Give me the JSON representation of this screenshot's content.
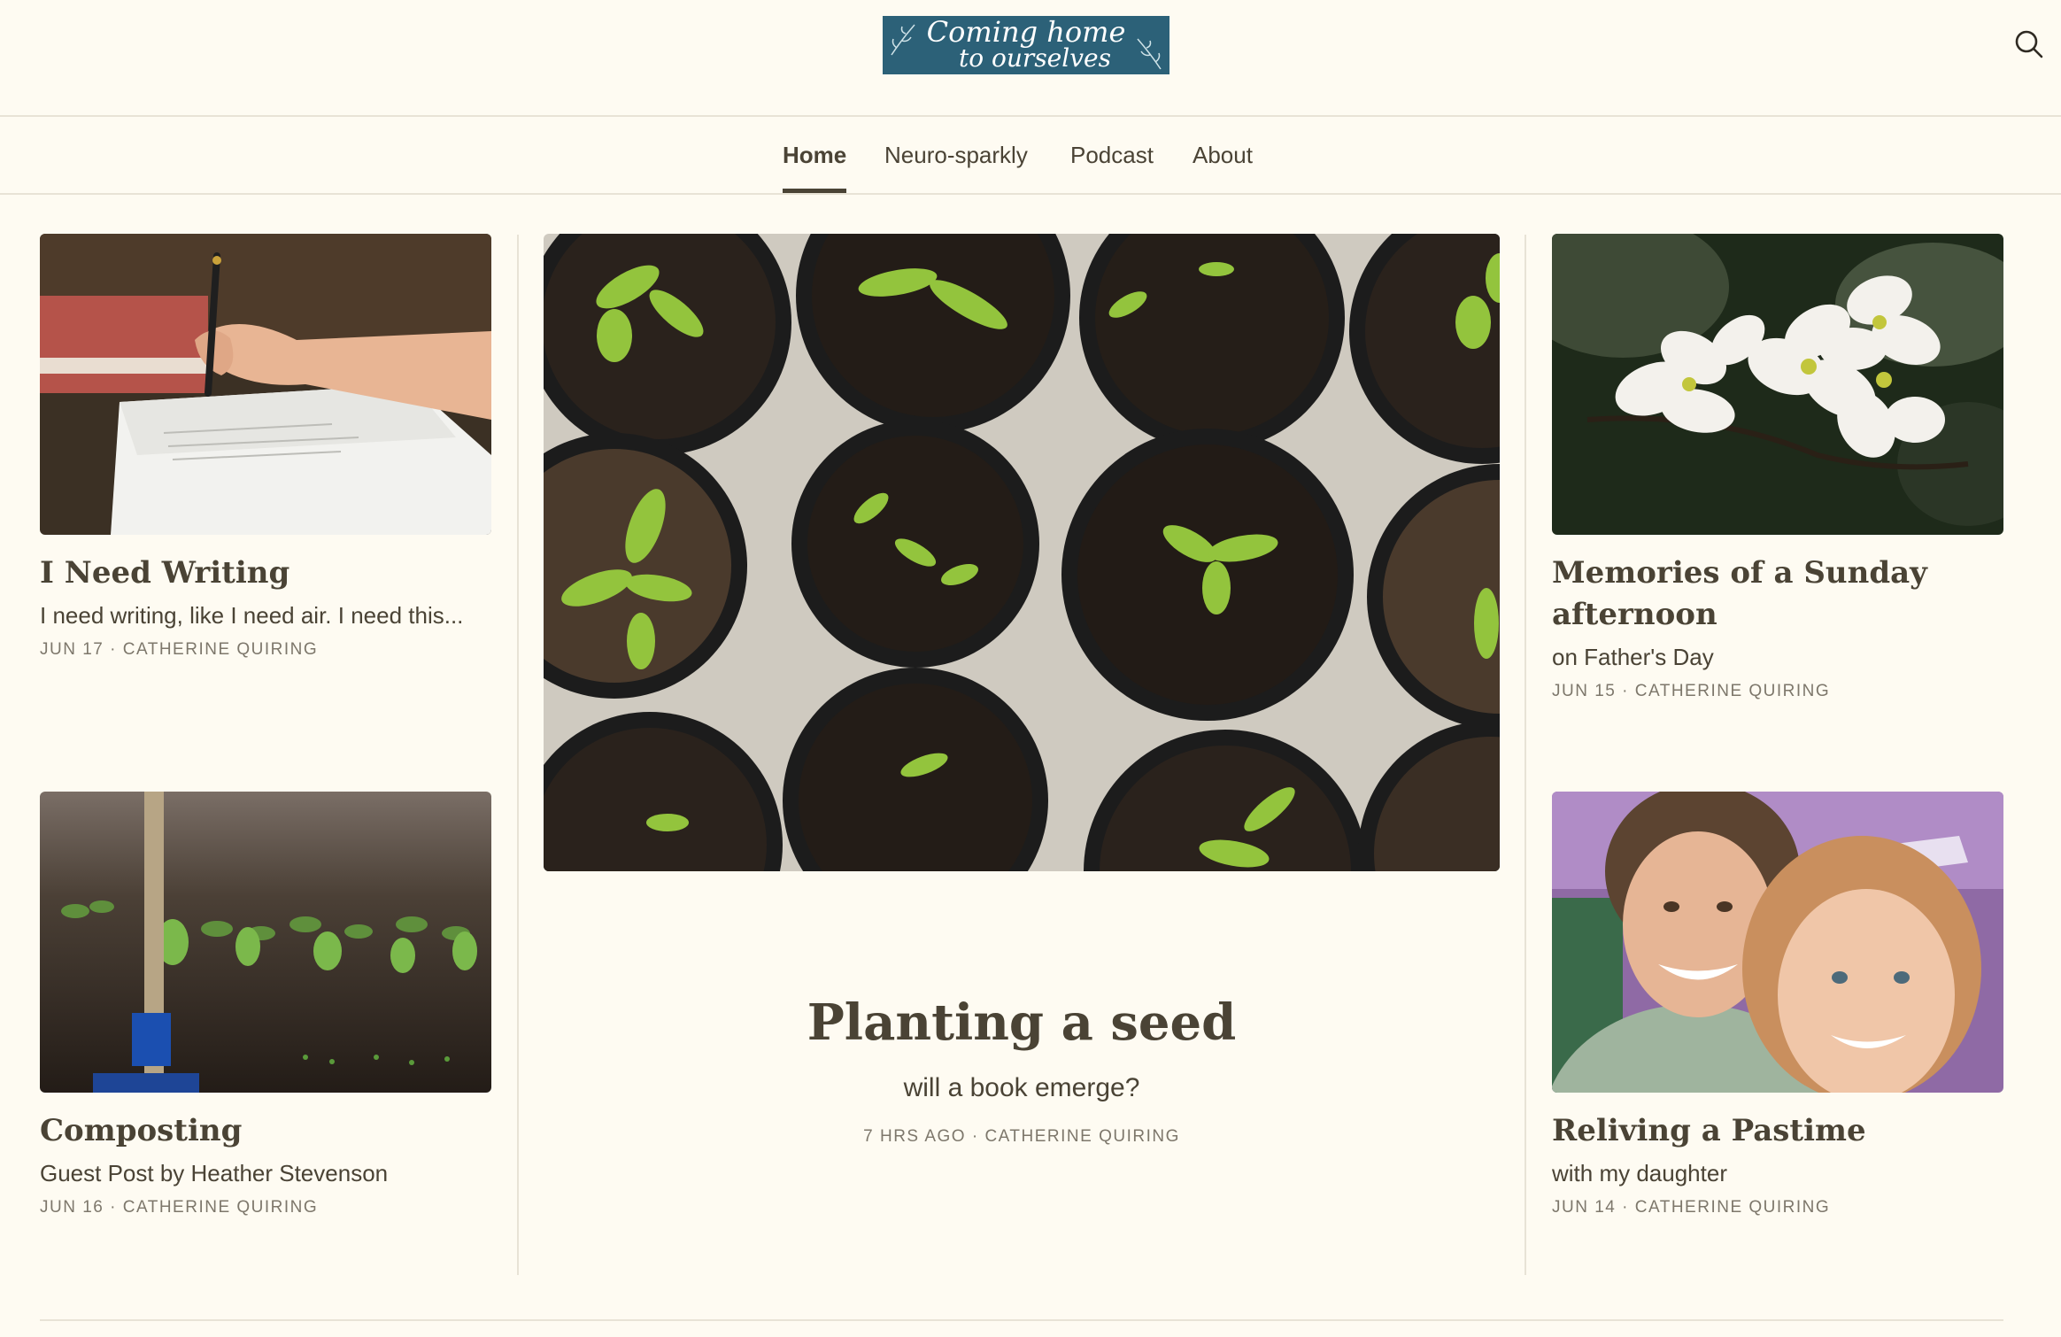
{
  "site": {
    "logo_line1": "Coming home",
    "logo_line2": "to ourselves"
  },
  "header": {
    "search_icon": "search-icon"
  },
  "nav": {
    "items": [
      {
        "label": "Home",
        "active": true
      },
      {
        "label": "Neuro-sparkly",
        "active": false
      },
      {
        "label": "Podcast",
        "active": false
      },
      {
        "label": "About",
        "active": false
      }
    ]
  },
  "posts": {
    "writing": {
      "title": "I Need Writing",
      "subtitle": "I need writing, like I need air. I need this...",
      "date": "JUN 17",
      "author": "CATHERINE QUIRING"
    },
    "composting": {
      "title": "Composting",
      "subtitle": "Guest Post by Heather Stevenson",
      "date": "JUN 16",
      "author": "CATHERINE QUIRING"
    },
    "featured": {
      "title": "Planting a seed",
      "subtitle": "will a book emerge?",
      "date": "7 HRS AGO",
      "author": "CATHERINE QUIRING"
    },
    "memories": {
      "title": "Memories of a Sunday afternoon",
      "subtitle": "on Father's Day",
      "date": "JUN 15",
      "author": "CATHERINE QUIRING"
    },
    "pastime": {
      "title": "Reliving a Pastime",
      "subtitle": "with my daughter",
      "date": "JUN 14",
      "author": "CATHERINE QUIRING"
    }
  },
  "meta_separator": "·",
  "colors": {
    "background": "#fefbf2",
    "text": "#4a4335",
    "meta": "#7d776b",
    "logo_bg": "#2c6178",
    "border": "#e8e3d6"
  }
}
